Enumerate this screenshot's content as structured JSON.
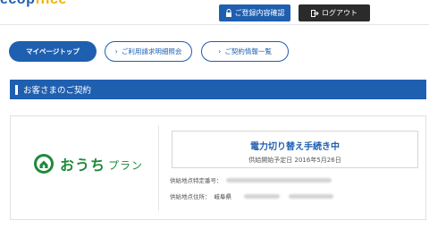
{
  "header": {
    "logo_main": "ecop",
    "logo_accent": "ffice",
    "register_button": "ご登録内容確認",
    "logout_button": "ログアウト"
  },
  "nav": {
    "top_label": "マイページトップ",
    "billing_label": "ご利用請求明細照会",
    "contracts_label": "ご契約情報一覧"
  },
  "section": {
    "title": "お客さまのご契約"
  },
  "plan": {
    "brand_name": "おうち",
    "brand_sub": "プラン"
  },
  "status": {
    "title": "電力切り替え手続き中",
    "start_label": "供給開始予定日",
    "start_date": "2016年5月26日"
  },
  "supply": {
    "number_label": "供給地点特定番号：",
    "address_label": "供給地点住所：",
    "address_prefecture": "岐阜県"
  },
  "colors": {
    "primary": "#1f5fb0",
    "brand_green": "#1e8a3a",
    "dark": "#2b2b2b"
  },
  "icons": [
    "lock-icon",
    "logout-icon",
    "chevron-right-icon",
    "house-logo-icon"
  ]
}
